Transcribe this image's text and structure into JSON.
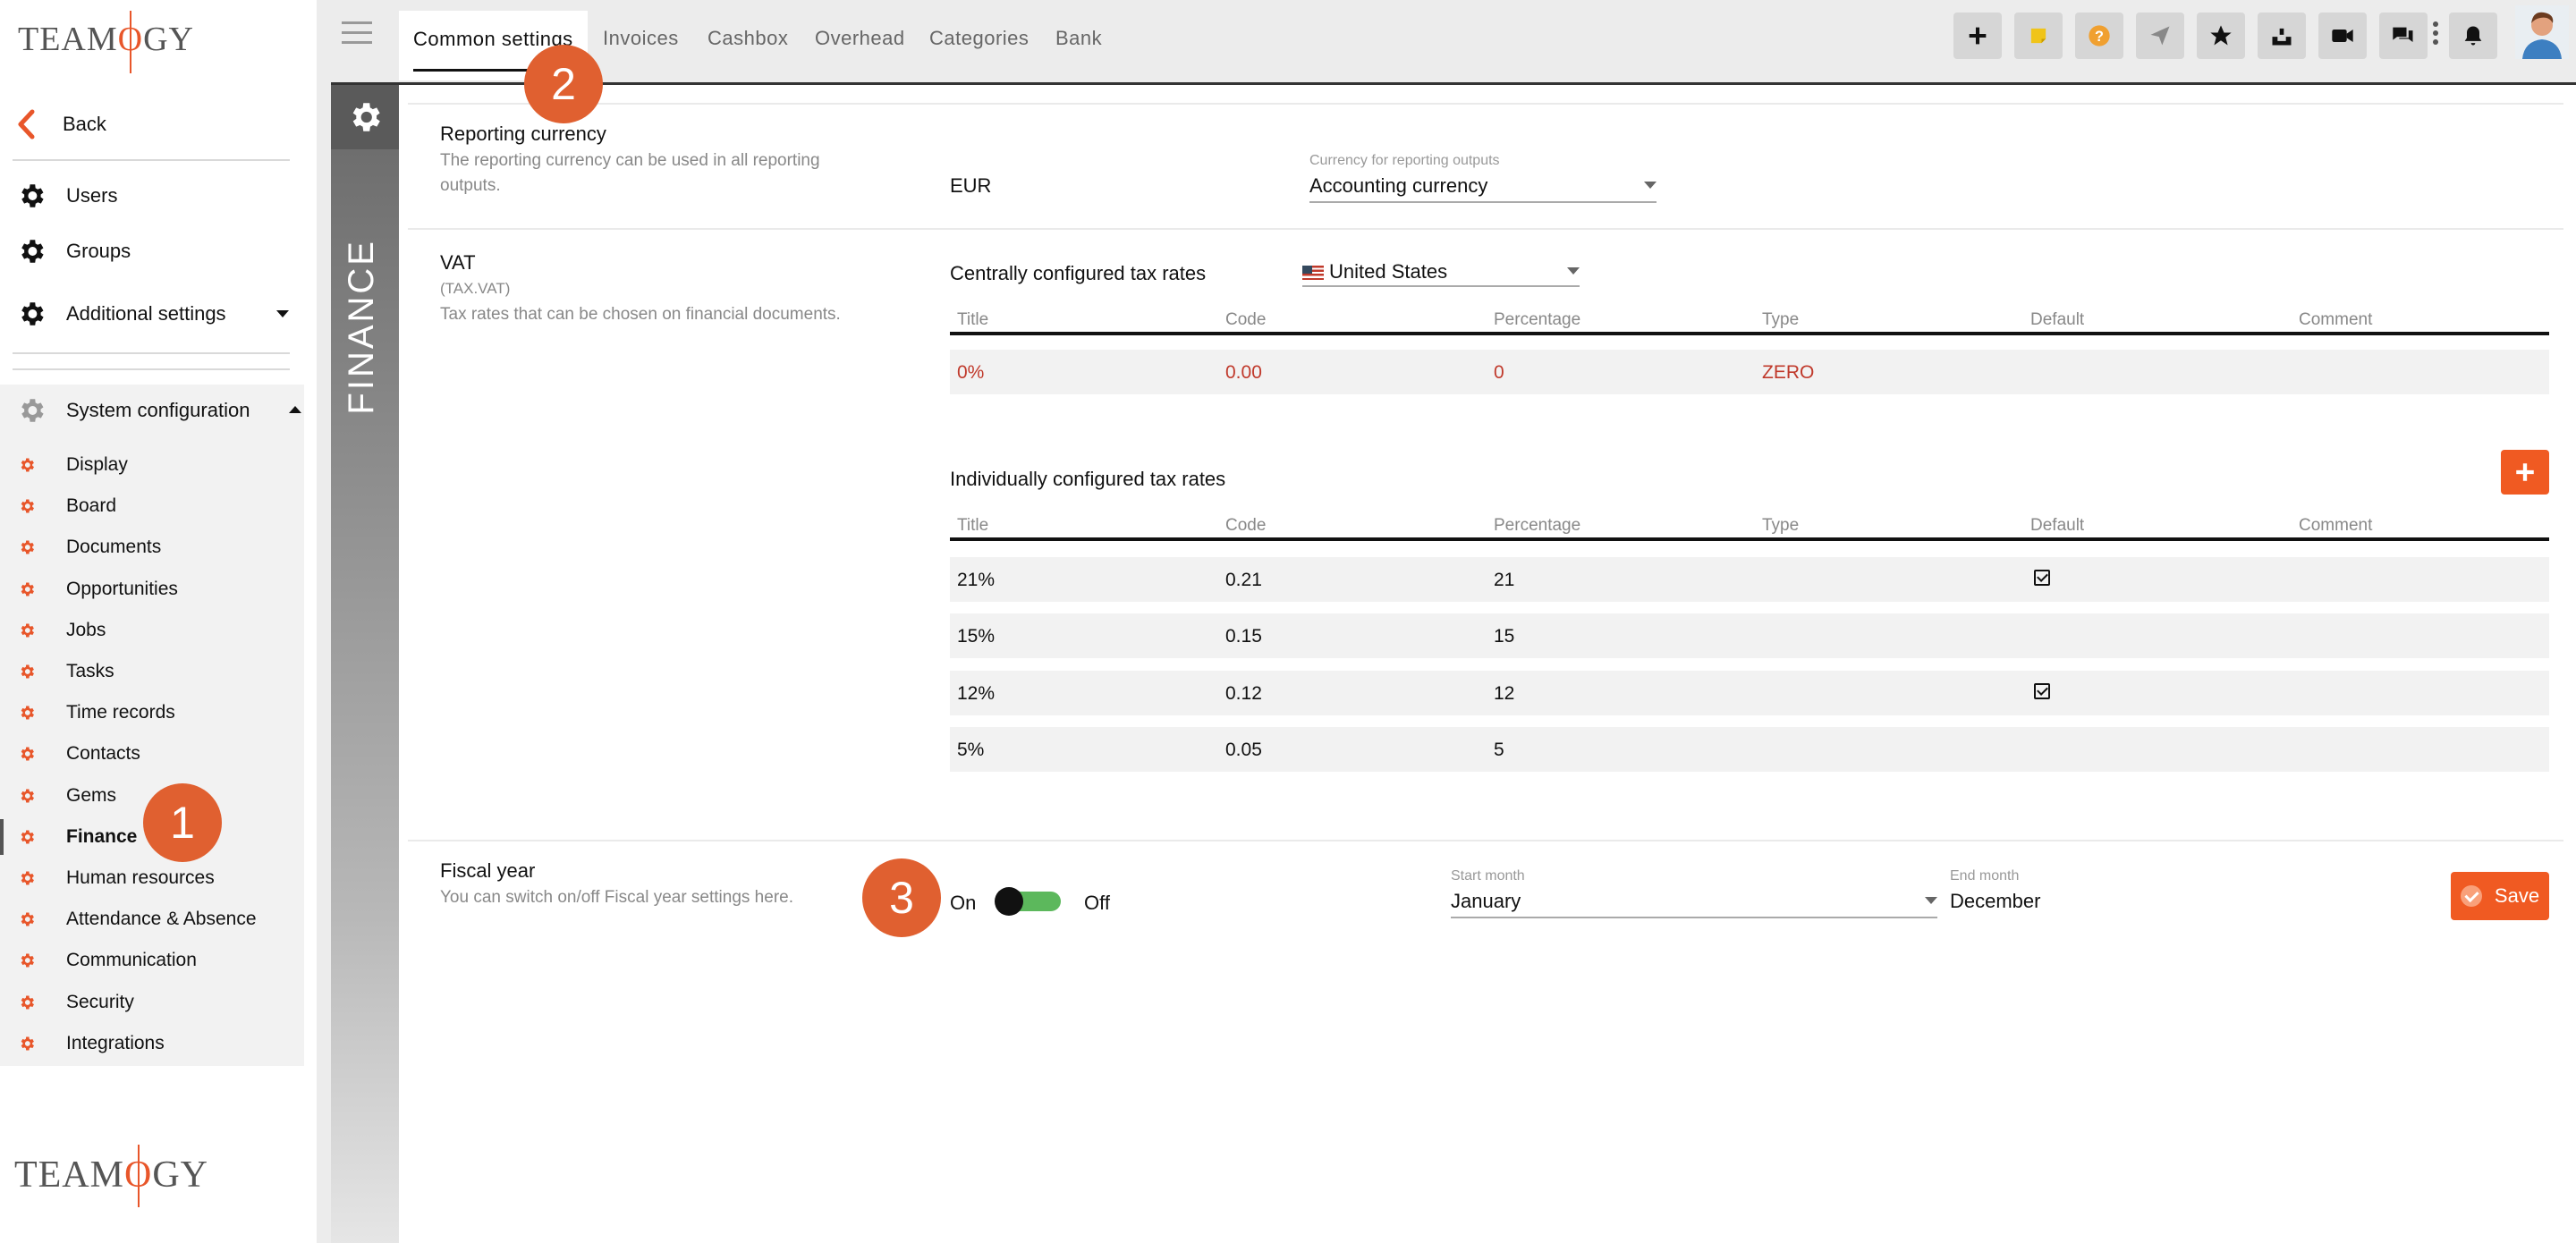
{
  "app": {
    "logo_text_left": "TEAM",
    "logo_text_mark": "O",
    "logo_text_right": "GY"
  },
  "sidebar": {
    "back_label": "Back",
    "users_label": "Users",
    "groups_label": "Groups",
    "additional_label": "Additional settings",
    "system_label": "System configuration",
    "items": [
      {
        "label": "Display"
      },
      {
        "label": "Board"
      },
      {
        "label": "Documents"
      },
      {
        "label": "Opportunities"
      },
      {
        "label": "Jobs"
      },
      {
        "label": "Tasks"
      },
      {
        "label": "Time records"
      },
      {
        "label": "Contacts"
      },
      {
        "label": "Gems"
      },
      {
        "label": "Finance"
      },
      {
        "label": "Human resources"
      },
      {
        "label": "Attendance & Absence"
      },
      {
        "label": "Communication"
      },
      {
        "label": "Security"
      },
      {
        "label": "Integrations"
      }
    ]
  },
  "topbar": {
    "tabs": [
      {
        "label": "Common settings"
      },
      {
        "label": "Invoices"
      },
      {
        "label": "Cashbox"
      },
      {
        "label": "Overhead"
      },
      {
        "label": "Categories"
      },
      {
        "label": "Bank"
      }
    ],
    "icons": [
      "plus-icon",
      "note-icon",
      "help-icon",
      "send-icon",
      "star-icon",
      "inbox-icon",
      "video-icon",
      "chat-icon",
      "bell-icon",
      "avatar"
    ]
  },
  "vertical_tab": {
    "label": "FINANCE"
  },
  "reporting": {
    "title": "Reporting currency",
    "desc_line1": "The reporting currency can be used in all reporting",
    "desc_line2": "outputs.",
    "currency": "EUR",
    "select_label": "Currency for reporting outputs",
    "select_value": "Accounting currency"
  },
  "vat": {
    "title": "VAT",
    "code": "(TAX.VAT)",
    "desc": "Tax rates that can be chosen on financial documents.",
    "central_label": "Centrally configured tax rates",
    "country": "United States",
    "individual_label": "Individually configured tax rates",
    "columns": [
      "Title",
      "Code",
      "Percentage",
      "Type",
      "Default",
      "Comment"
    ],
    "central_rows": [
      {
        "title": "0%",
        "code": "0.00",
        "percentage": "0",
        "type": "ZERO",
        "default": false,
        "comment": ""
      }
    ],
    "individual_rows": [
      {
        "title": "21%",
        "code": "0.21",
        "percentage": "21",
        "type": "",
        "default": true,
        "comment": ""
      },
      {
        "title": "15%",
        "code": "0.15",
        "percentage": "15",
        "type": "",
        "default": false,
        "comment": ""
      },
      {
        "title": "12%",
        "code": "0.12",
        "percentage": "12",
        "type": "",
        "default": true,
        "comment": ""
      },
      {
        "title": "5%",
        "code": "0.05",
        "percentage": "5",
        "type": "",
        "default": false,
        "comment": ""
      }
    ]
  },
  "fiscal": {
    "title": "Fiscal year",
    "desc": "You can switch on/off Fiscal year settings here.",
    "on_label": "On",
    "off_label": "Off",
    "start_label": "Start month",
    "start_value": "January",
    "end_label": "End month",
    "end_value": "December",
    "save_label": "Save"
  },
  "badges": [
    "1",
    "2",
    "3"
  ],
  "colors": {
    "accent": "#f05a22",
    "badge": "#e06030",
    "toggle": "#5cb85c",
    "red_text": "#c0392b"
  }
}
